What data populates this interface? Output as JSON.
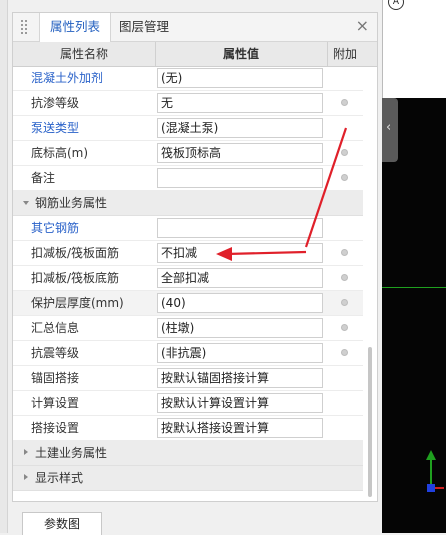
{
  "tabs": [
    {
      "label": "属性列表",
      "active": true
    },
    {
      "label": "图层管理",
      "active": false
    }
  ],
  "close_glyph": "×",
  "table": {
    "headers": {
      "name": "属性名称",
      "value": "属性值",
      "add": "附加"
    }
  },
  "rows": [
    {
      "type": "prop",
      "name": "混凝土外加剂",
      "value": "(无)",
      "blue": true,
      "dot": false
    },
    {
      "type": "prop",
      "name": "抗渗等级",
      "value": "无",
      "blue": false,
      "dot": true
    },
    {
      "type": "prop",
      "name": "泵送类型",
      "value": "(混凝土泵)",
      "blue": true,
      "dot": false
    },
    {
      "type": "prop",
      "name": "底标高(m)",
      "value": "筏板顶标高",
      "blue": false,
      "dot": true
    },
    {
      "type": "prop",
      "name": "备注",
      "value": "",
      "blue": false,
      "dot": true
    },
    {
      "type": "group",
      "name": "钢筋业务属性",
      "expanded": true
    },
    {
      "type": "prop",
      "name": "其它钢筋",
      "value": "",
      "blue": true,
      "dot": false
    },
    {
      "type": "prop",
      "name": "扣减板/筏板面筋",
      "value": "不扣减",
      "blue": false,
      "dot": true
    },
    {
      "type": "prop",
      "name": "扣减板/筏板底筋",
      "value": "全部扣减",
      "blue": false,
      "dot": true
    },
    {
      "type": "prop",
      "name": "保护层厚度(mm)",
      "value": "(40)",
      "blue": false,
      "dot": true,
      "shaded": true
    },
    {
      "type": "prop",
      "name": "汇总信息",
      "value": "(柱墩)",
      "blue": false,
      "dot": true
    },
    {
      "type": "prop",
      "name": "抗震等级",
      "value": "(非抗震)",
      "blue": false,
      "dot": true
    },
    {
      "type": "prop",
      "name": "锚固搭接",
      "value": "按默认锚固搭接计算",
      "blue": false,
      "dot": false
    },
    {
      "type": "prop",
      "name": "计算设置",
      "value": "按默认计算设置计算",
      "blue": false,
      "dot": false
    },
    {
      "type": "prop",
      "name": "搭接设置",
      "value": "按默认搭接设置计算",
      "blue": false,
      "dot": false
    },
    {
      "type": "group",
      "name": "土建业务属性",
      "expanded": false
    },
    {
      "type": "group",
      "name": "显示样式",
      "expanded": false
    }
  ],
  "bottom_tab": "参数图",
  "viewport": {
    "axis_label": "A",
    "side_handle_glyph": "‹"
  },
  "colors": {
    "accent_blue": "#2561c0",
    "link_blue": "#2a62c9",
    "arrow_red": "#e0202a",
    "axis_green": "#1fa01f"
  }
}
